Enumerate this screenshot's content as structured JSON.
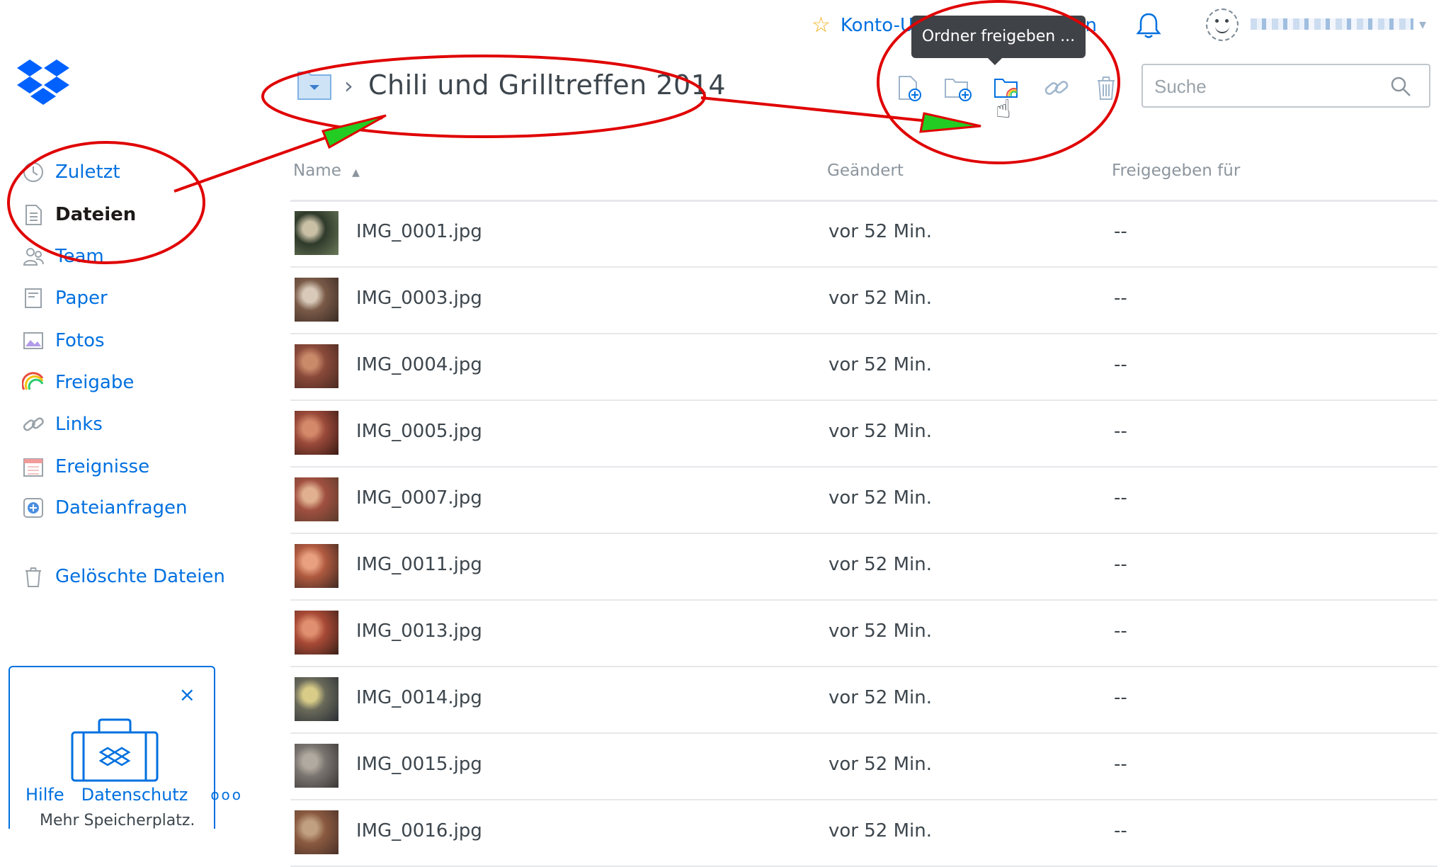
{
  "topbar": {
    "upgrade_label": "Konto-Upgrade durchführen",
    "tooltip": "Ordner freigeben ...",
    "user_name": "",
    "bell_icon": "bell-icon",
    "avatar_icon": "avatar-icon"
  },
  "breadcrumb": {
    "title": "Chili und Grilltreffen 2014",
    "separator": "›"
  },
  "search": {
    "placeholder": "Suche"
  },
  "sidebar": {
    "items": [
      {
        "label": "Zuletzt",
        "icon": "clock-icon",
        "active": false
      },
      {
        "label": "Dateien",
        "icon": "file-icon",
        "active": true
      },
      {
        "label": "Team",
        "icon": "team-icon",
        "active": false
      },
      {
        "label": "Paper",
        "icon": "paper-icon",
        "active": false
      },
      {
        "label": "Fotos",
        "icon": "photo-icon",
        "active": false
      },
      {
        "label": "Freigabe",
        "icon": "rainbow-icon",
        "active": false
      },
      {
        "label": "Links",
        "icon": "link-icon",
        "active": false
      },
      {
        "label": "Ereignisse",
        "icon": "calendar-icon",
        "active": false
      },
      {
        "label": "Dateianfragen",
        "icon": "file-request-icon",
        "active": false
      },
      {
        "label": "Gelöschte Dateien",
        "icon": "trash-icon",
        "active": false
      }
    ]
  },
  "promo": {
    "close": "×",
    "text": "Mehr Speicherplatz."
  },
  "footer": {
    "help": "Hilfe",
    "privacy": "Datenschutz",
    "more": "ooo"
  },
  "table": {
    "headers": {
      "name": "Name",
      "modified": "Geändert",
      "shared": "Freigegeben für"
    },
    "sort_indicator": "▲",
    "rows": [
      {
        "name": "IMG_0001.jpg",
        "modified": "vor 52 Min.",
        "shared": "--"
      },
      {
        "name": "IMG_0003.jpg",
        "modified": "vor 52 Min.",
        "shared": "--"
      },
      {
        "name": "IMG_0004.jpg",
        "modified": "vor 52 Min.",
        "shared": "--"
      },
      {
        "name": "IMG_0005.jpg",
        "modified": "vor 52 Min.",
        "shared": "--"
      },
      {
        "name": "IMG_0007.jpg",
        "modified": "vor 52 Min.",
        "shared": "--"
      },
      {
        "name": "IMG_0011.jpg",
        "modified": "vor 52 Min.",
        "shared": "--"
      },
      {
        "name": "IMG_0013.jpg",
        "modified": "vor 52 Min.",
        "shared": "--"
      },
      {
        "name": "IMG_0014.jpg",
        "modified": "vor 52 Min.",
        "shared": "--"
      },
      {
        "name": "IMG_0015.jpg",
        "modified": "vor 52 Min.",
        "shared": "--"
      },
      {
        "name": "IMG_0016.jpg",
        "modified": "vor 52 Min.",
        "shared": "--"
      }
    ]
  },
  "colors": {
    "accent": "#0070e0",
    "annotation": "#e00000",
    "arrowhead": "#22cc22"
  }
}
